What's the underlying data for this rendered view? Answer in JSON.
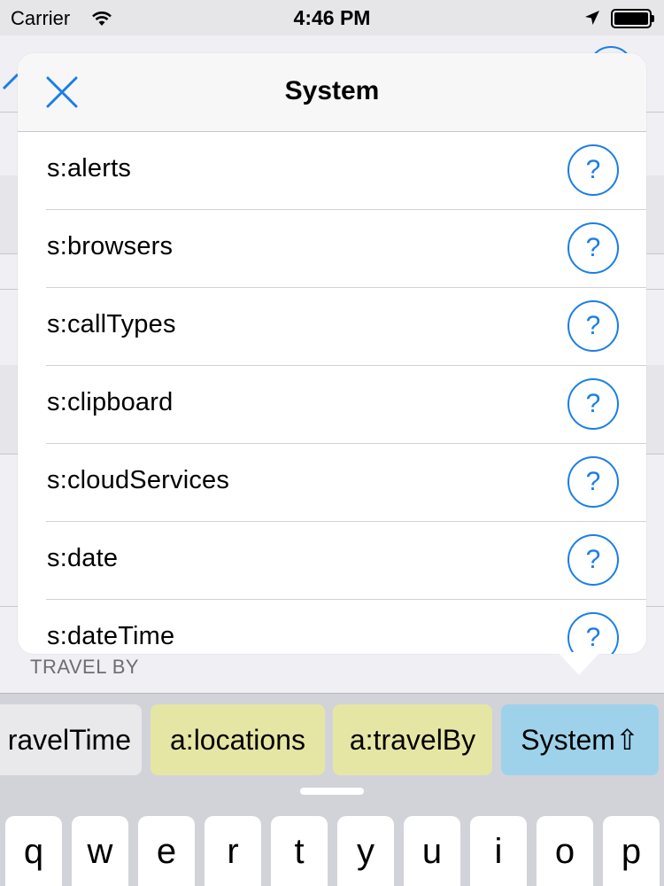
{
  "status_bar": {
    "carrier": "Carrier",
    "time": "4:46 PM"
  },
  "background": {
    "section_label": "TRAVEL BY"
  },
  "popover": {
    "title": "System",
    "items": [
      {
        "label": "s:alerts",
        "help": "?"
      },
      {
        "label": "s:browsers",
        "help": "?"
      },
      {
        "label": "s:callTypes",
        "help": "?"
      },
      {
        "label": "s:clipboard",
        "help": "?"
      },
      {
        "label": "s:cloudServices",
        "help": "?"
      },
      {
        "label": "s:date",
        "help": "?"
      },
      {
        "label": "s:dateTime",
        "help": "?"
      }
    ]
  },
  "suggestions": [
    "ravelTime",
    "a:locations",
    "a:travelBy",
    "System⇧"
  ],
  "keyboard": {
    "row1": [
      "q",
      "w",
      "e",
      "r",
      "t",
      "y",
      "u",
      "i",
      "o",
      "p"
    ]
  },
  "colors": {
    "accent": "#1a7ee6",
    "suggestion_yellow": "#e6e6a4",
    "suggestion_blue": "#9ed2ea"
  }
}
